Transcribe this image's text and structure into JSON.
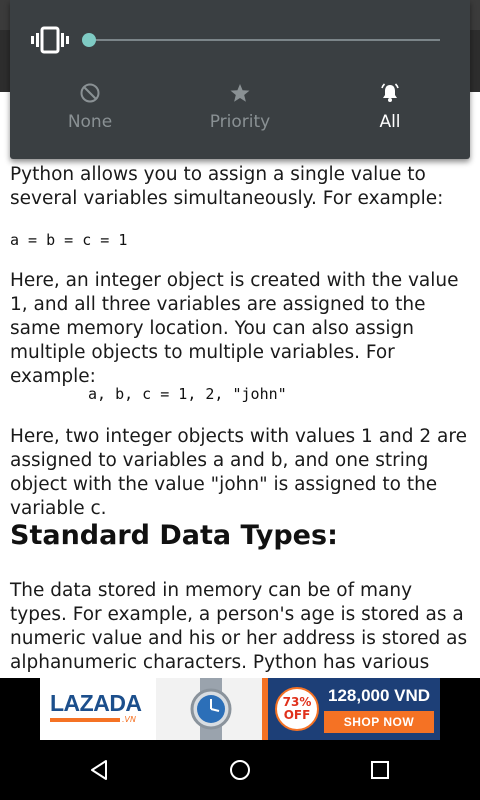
{
  "volume_panel": {
    "ringer_icon": "vibrate-icon",
    "volume_level": 0.0,
    "modes": [
      {
        "label": "None",
        "icon": "none-icon",
        "selected": false
      },
      {
        "label": "Priority",
        "icon": "star-icon",
        "selected": false
      },
      {
        "label": "All",
        "icon": "bell-icon",
        "selected": true
      }
    ]
  },
  "article": {
    "p1": "Python allows you to assign a single value to several variables simultaneously. For example:",
    "code1": "a = b = c = 1",
    "p2": "Here, an integer object is created with the value 1, and all three variables are assigned to the same memory location. You can also assign multiple objects to multiple variables. For example:",
    "code2": "a, b, c = 1, 2, \"john\"",
    "p3": "Here, two integer objects with values 1 and 2 are assigned to variables a and b, and one string object with the value \"john\" is assigned to the variable c.",
    "heading": "Standard Data Types:",
    "p4": "The data stored in memory can be of many types. For example, a person's age is stored as a numeric value and his or her address is stored as alphanumeric characters. Python has various"
  },
  "ad": {
    "brand": "LAZADA",
    "brand_suffix": ".VN",
    "discount_pct": "73%",
    "discount_off": "OFF",
    "price": "128,000 VND",
    "cta": "SHOP NOW"
  },
  "navbar": {
    "back_icon": "back-icon",
    "home_icon": "home-icon",
    "recents_icon": "recents-icon"
  },
  "colors": {
    "panel_bg": "#3a3f42",
    "accent": "#7fcbc4",
    "selected_text": "#ffffff",
    "unselected_text": "#8a9194",
    "brand_orange": "#f57224",
    "brand_blue": "#1d3f77"
  }
}
